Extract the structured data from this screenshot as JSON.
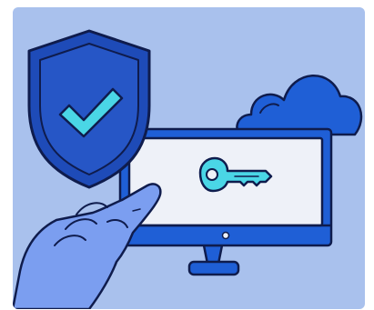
{
  "illustration": {
    "subject": "security-access",
    "icons": [
      "shield-check-icon",
      "cloud-icon",
      "monitor-icon",
      "key-icon",
      "pointing-hand-icon"
    ]
  },
  "colors": {
    "background": "#a9c1ed",
    "outline": "#0f1c4d",
    "shield": "#1e4bb8",
    "check": "#4ad6e6",
    "cloud": "#1f5fd6",
    "monitor_frame": "#1f5fd6",
    "screen": "#eef1f8",
    "key": "#4ad6e6",
    "hand": "#7b9ef0"
  }
}
